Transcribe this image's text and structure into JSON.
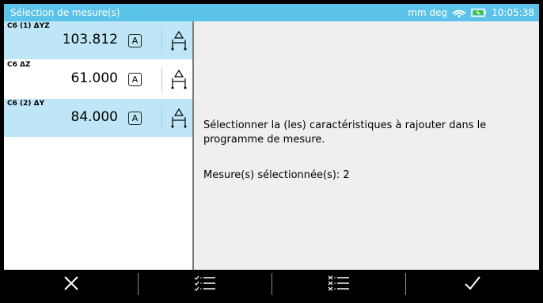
{
  "titlebar": {
    "title": "Sélection de mesure(s)",
    "units": "mm deg",
    "time": "10:05:38",
    "icons": [
      "wifi-icon",
      "battery-icon"
    ]
  },
  "list": {
    "items": [
      {
        "name": "C6 (1) ΔYZ",
        "value": "103.812",
        "mode": "A",
        "selected": true
      },
      {
        "name": "C6 ΔZ",
        "value": "61.000",
        "mode": "A",
        "selected": false
      },
      {
        "name": "C6 (2) ΔY",
        "value": "84.000",
        "mode": "A",
        "selected": true
      }
    ]
  },
  "content": {
    "message": "Sélectionner la (les) caractéristiques à rajouter dans le programme de mesure.",
    "count_label": "Mesure(s) sélectionnée(s): 2"
  },
  "toolbar": {
    "buttons": [
      "cancel-icon",
      "select-all-icon",
      "deselect-all-icon",
      "confirm-icon"
    ]
  },
  "colors": {
    "titlebar": "#5bc3ea",
    "selected_row": "#bfe6f7",
    "content_bg": "#efefef",
    "toolbar_bg": "#000000"
  }
}
